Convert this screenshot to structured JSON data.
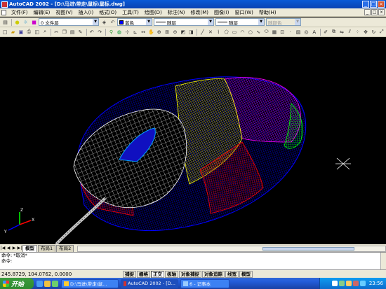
{
  "window": {
    "title": "AutoCAD 2002 - [D:\\马进\\带走\\鼠标\\鼠标.dwg]",
    "controls": [
      "_",
      "□",
      "×"
    ]
  },
  "menu": {
    "items": [
      "文件(F)",
      "编辑(E)",
      "视图(V)",
      "插入(I)",
      "格式(O)",
      "工具(T)",
      "绘图(D)",
      "标注(N)",
      "修改(M)",
      "图像(I)",
      "窗口(W)",
      "帮助(H)"
    ],
    "mdi_controls": [
      "_",
      "□",
      "×"
    ]
  },
  "properties_toolbar": {
    "layer_value": "0 文件层",
    "color_value": "蓝色",
    "linetype_value": "随层",
    "lineweight_value": "随层",
    "plotstyle_value": "随颜色"
  },
  "tabs": {
    "nav": [
      "|◀",
      "◀",
      "▶",
      "▶|"
    ],
    "items": [
      "模型",
      "布局1",
      "布局2"
    ]
  },
  "command": {
    "line1": "命令: *取消*",
    "line2": "命令:"
  },
  "status": {
    "coordinates": "245.8729, 104.0762, 0.0000",
    "modes": [
      "捕捉",
      "栅格",
      "正交",
      "极轴",
      "对象捕捉",
      "对象追踪",
      "线宽",
      "模型"
    ]
  },
  "taskbar": {
    "start_label": "开始",
    "tasks": [
      "D:\\马进\\带走\\鼠...",
      "AutoCAD 2002 - [D...",
      "6 - 记事本"
    ],
    "clock": "23:56"
  },
  "colors": {
    "wire_black_shell": "#ffffff",
    "wire_yellow": "#ffff00",
    "wire_magenta": "#ff00ff",
    "wire_blue": "#0000ff",
    "wire_red": "#ff0000",
    "wire_green": "#00ff00"
  },
  "ucs": {
    "x_label": "X",
    "y_label": "Y",
    "z_label": "Z"
  }
}
